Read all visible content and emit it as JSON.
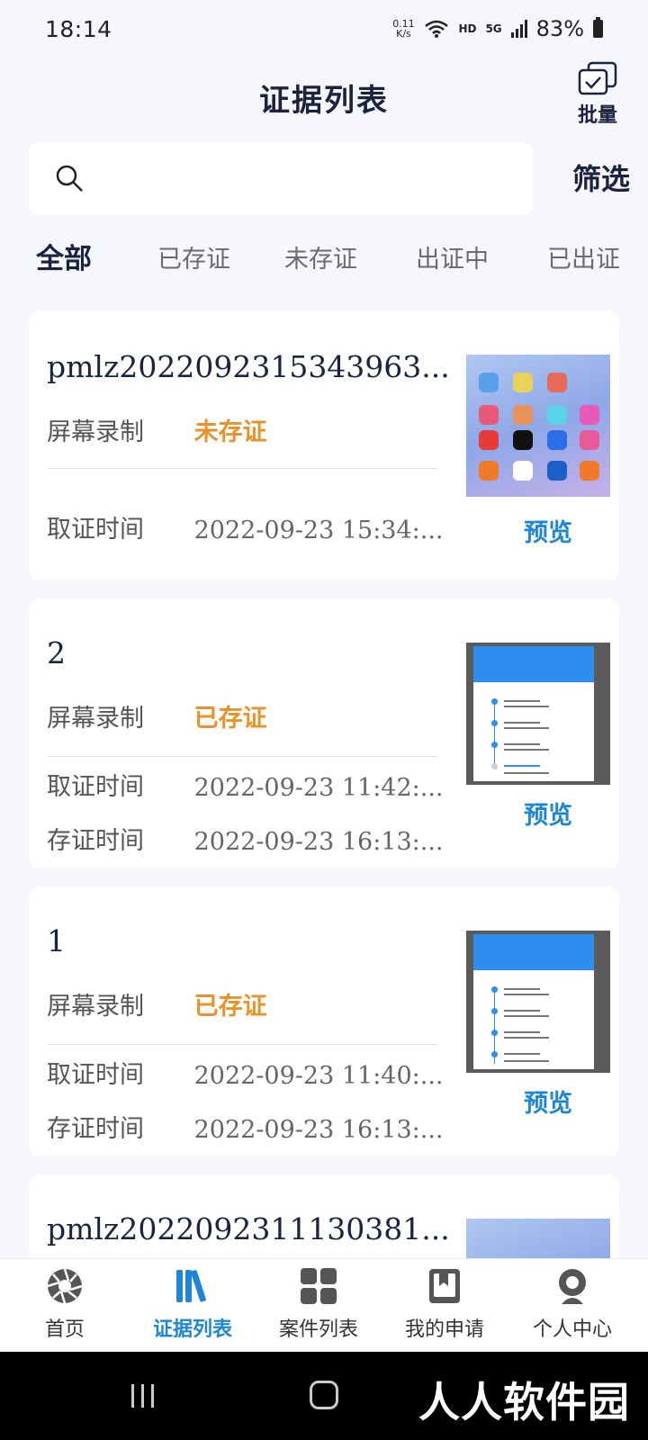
{
  "status_bar": {
    "time": "18:14",
    "net_speed_value": "0.11",
    "net_speed_unit": "K/s",
    "hd": "HD",
    "network": "5G",
    "battery": "83%"
  },
  "header": {
    "title": "证据列表",
    "batch_label": "批量"
  },
  "search": {
    "placeholder": "",
    "filter_label": "筛选"
  },
  "tabs": [
    "全部",
    "已存证",
    "未存证",
    "出证中",
    "已出证"
  ],
  "active_tab": 0,
  "cards": [
    {
      "title": "pmlz2022092315343963...",
      "type": "屏幕录制",
      "status": "未存证",
      "acquire_label": "取证时间",
      "acquire_time": "2022-09-23 15:34:...",
      "store_label": "",
      "store_time": "",
      "preview": "预览"
    },
    {
      "title": "2",
      "type": "屏幕录制",
      "status": "已存证",
      "acquire_label": "取证时间",
      "acquire_time": "2022-09-23 11:42:...",
      "store_label": "存证时间",
      "store_time": "2022-09-23 16:13:...",
      "preview": "预览"
    },
    {
      "title": "1",
      "type": "屏幕录制",
      "status": "已存证",
      "acquire_label": "取证时间",
      "acquire_time": "2022-09-23 11:40:...",
      "store_label": "存证时间",
      "store_time": "2022-09-23 16:13:...",
      "preview": "预览"
    },
    {
      "title": "pmlz2022092311130381..."
    }
  ],
  "bottom_nav": [
    {
      "label": "首页",
      "icon": "shutter-icon"
    },
    {
      "label": "证据列表",
      "icon": "books-icon"
    },
    {
      "label": "案件列表",
      "icon": "grid-icon"
    },
    {
      "label": "我的申请",
      "icon": "bookmark-book-icon"
    },
    {
      "label": "个人中心",
      "icon": "person-icon"
    }
  ],
  "active_nav": 1,
  "watermark": "人人软件园",
  "colors": {
    "primary": "#1e86d8",
    "status_orange": "#e8922a",
    "title_navy": "#1b2340",
    "background": "#f6f7fb"
  }
}
